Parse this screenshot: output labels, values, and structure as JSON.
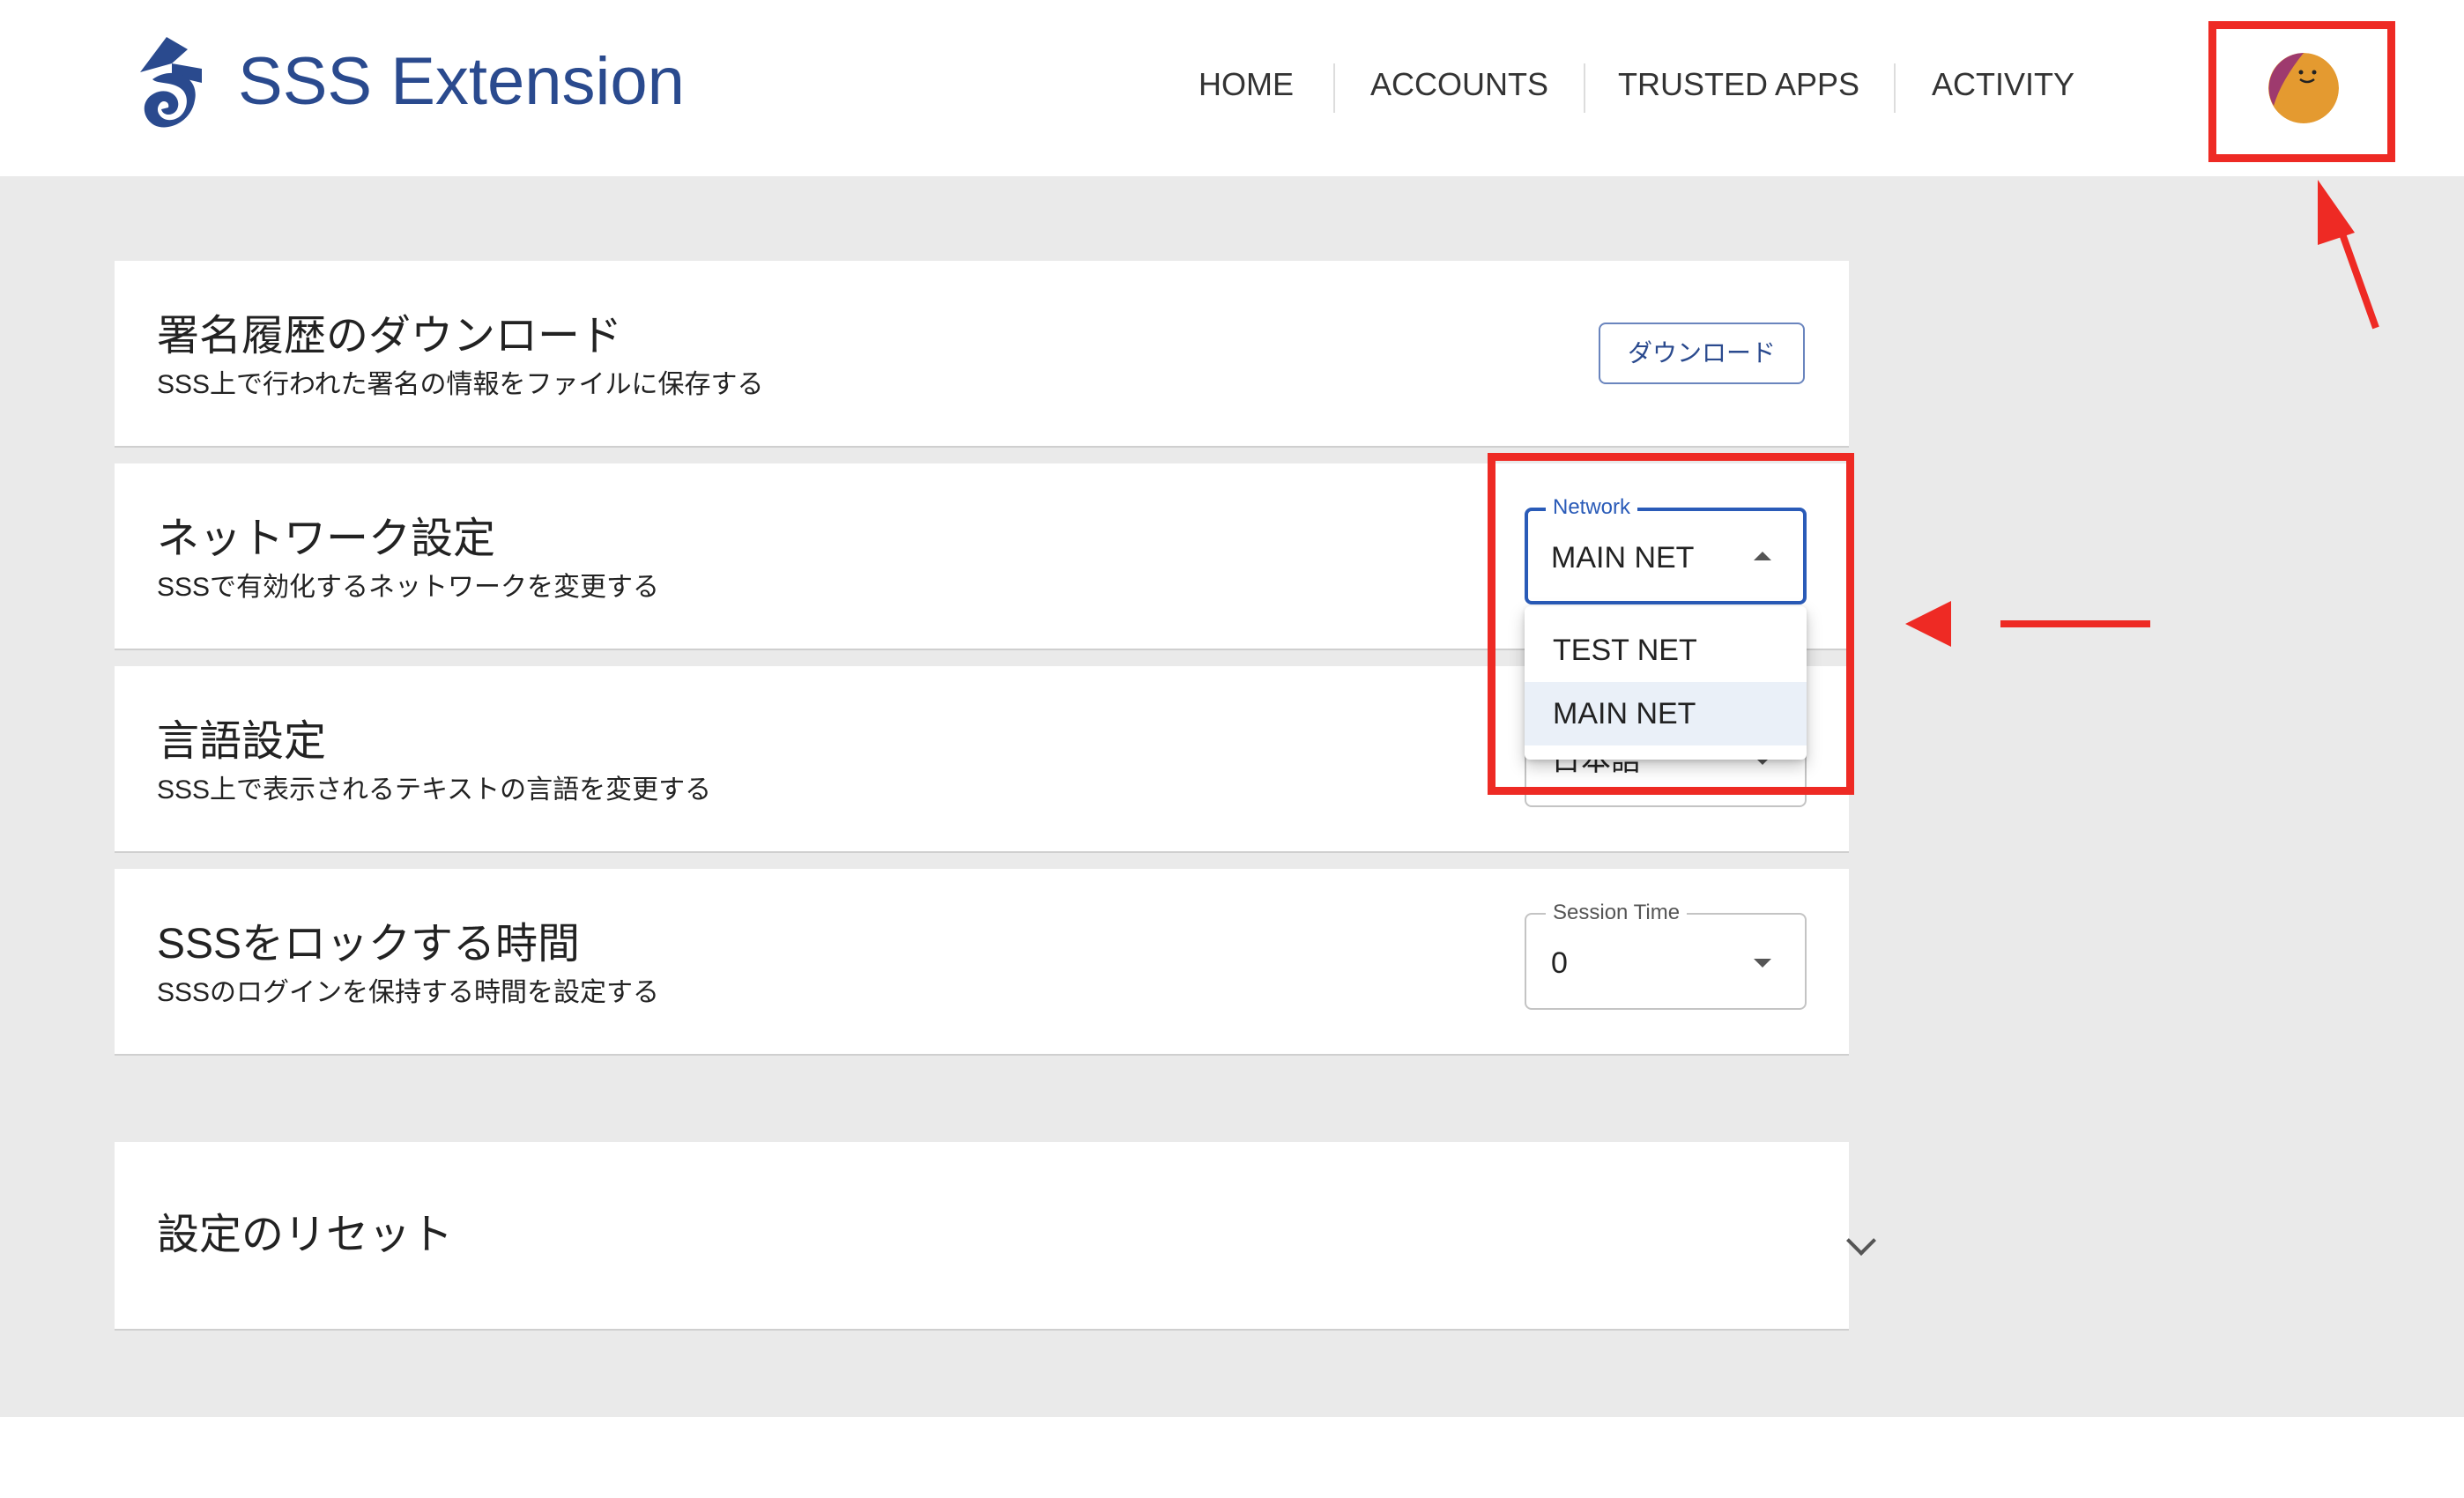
{
  "header": {
    "logo_text": "SSS Extension",
    "nav": [
      {
        "label": "HOME"
      },
      {
        "label": "ACCOUNTS"
      },
      {
        "label": "TRUSTED APPS"
      },
      {
        "label": "ACTIVITY"
      }
    ],
    "avatar_icon": "face-avatar-icon"
  },
  "settings": {
    "download": {
      "title": "署名履歴のダウンロード",
      "subtitle": "SSS上で行われた署名の情報をファイルに保存する",
      "button_label": "ダウンロード"
    },
    "network": {
      "title": "ネットワーク設定",
      "subtitle": "SSSで有効化するネットワークを変更する",
      "select_label": "Network",
      "selected_value": "MAIN NET",
      "options": [
        "TEST NET",
        "MAIN NET"
      ]
    },
    "language": {
      "title": "言語設定",
      "subtitle": "SSS上で表示されるテキストの言語を変更する",
      "selected_value": "日本語"
    },
    "session": {
      "title": "SSSをロックする時間",
      "subtitle": "SSSのログインを保持する時間を設定する",
      "select_label": "Session Time",
      "selected_value": "0"
    },
    "reset": {
      "title": "設定のリセット"
    }
  },
  "colors": {
    "brand": "#2a4a8e",
    "accent_focus": "#2a5bb8",
    "highlight": "#ee2a24",
    "page_bg": "#eaeaea",
    "avatar": "#e49a30"
  }
}
